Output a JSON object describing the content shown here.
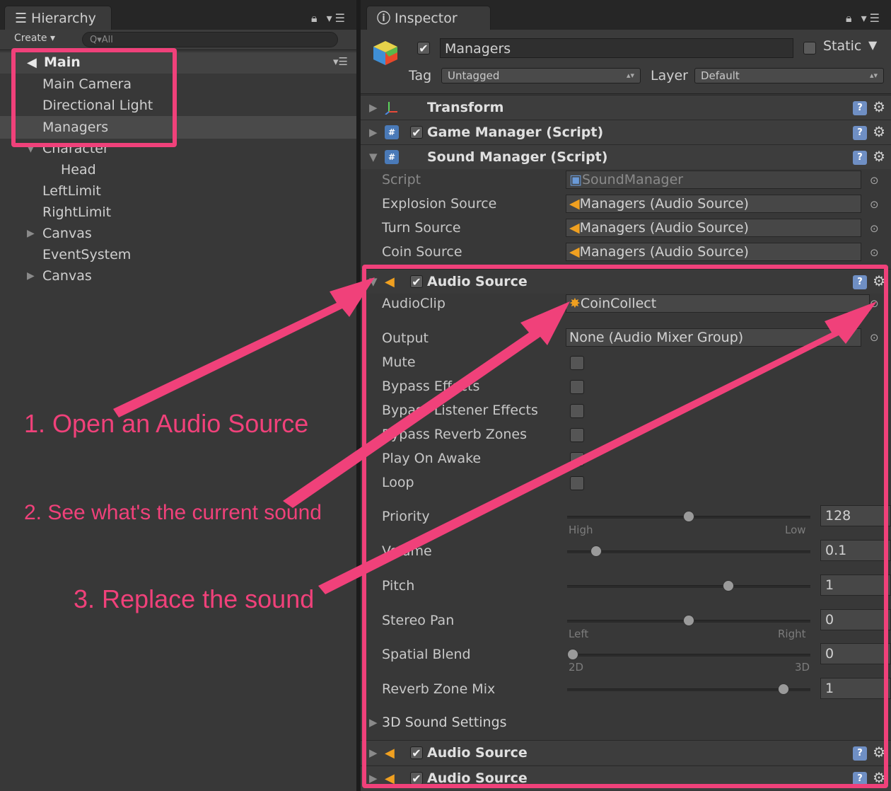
{
  "hierarchy": {
    "tab_title": "Hierarchy",
    "create_label": "Create ▾",
    "search_placeholder": "Q▾All",
    "scene_name": "Main",
    "items": [
      {
        "label": "Main Camera"
      },
      {
        "label": "Directional Light"
      },
      {
        "label": "Managers"
      },
      {
        "label": "Character"
      },
      {
        "label": "Head"
      },
      {
        "label": "LeftLimit"
      },
      {
        "label": "RightLimit"
      },
      {
        "label": "Canvas"
      },
      {
        "label": "EventSystem"
      },
      {
        "label": "Canvas"
      }
    ]
  },
  "inspector": {
    "tab_title": "Inspector",
    "object_name": "Managers",
    "static_label": "Static",
    "tag_label": "Tag",
    "tag_value": "Untagged",
    "layer_label": "Layer",
    "layer_value": "Default",
    "components": {
      "transform": "Transform",
      "game_manager": "Game Manager (Script)",
      "sound_manager": "Sound Manager (Script)",
      "audio_source": "Audio Source",
      "sound_3d": "3D Sound Settings",
      "audio_source_2": "Audio Source",
      "audio_source_3": "Audio Source"
    },
    "sound_manager_props": {
      "script_label": "Script",
      "script_value": "SoundManager",
      "explosion_label": "Explosion Source",
      "explosion_value": "Managers (Audio Source)",
      "turn_label": "Turn Source",
      "turn_value": "Managers (Audio Source)",
      "coin_label": "Coin Source",
      "coin_value": "Managers (Audio Source)"
    },
    "audio_props": {
      "audioclip_label": "AudioClip",
      "audioclip_value": "CoinCollect",
      "output_label": "Output",
      "output_value": "None (Audio Mixer Group)",
      "mute_label": "Mute",
      "bypass_effects_label": "Bypass Effects",
      "bypass_listener_label": "Bypass Listener Effects",
      "bypass_reverb_label": "Bypass Reverb Zones",
      "play_on_awake_label": "Play On Awake",
      "loop_label": "Loop",
      "priority_label": "Priority",
      "priority_value": "128",
      "priority_min": "High",
      "priority_max": "Low",
      "volume_label": "Volume",
      "volume_value": "0.1",
      "pitch_label": "Pitch",
      "pitch_value": "1",
      "stereo_label": "Stereo Pan",
      "stereo_value": "0",
      "stereo_min": "Left",
      "stereo_max": "Right",
      "spatial_label": "Spatial Blend",
      "spatial_value": "0",
      "spatial_min": "2D",
      "spatial_max": "3D",
      "reverb_mix_label": "Reverb Zone Mix",
      "reverb_mix_value": "1"
    },
    "slider_levels": {
      "priority": 0.5,
      "volume": 0.1,
      "pitch": 0.67,
      "stereo": 0.5,
      "spatial": 0.0,
      "reverb": 0.91
    }
  },
  "annotations": {
    "step1": "1. Open an Audio Source",
    "step2": "2. See what's the current sound",
    "step3": "3. Replace the sound",
    "color": "#f0417a"
  }
}
